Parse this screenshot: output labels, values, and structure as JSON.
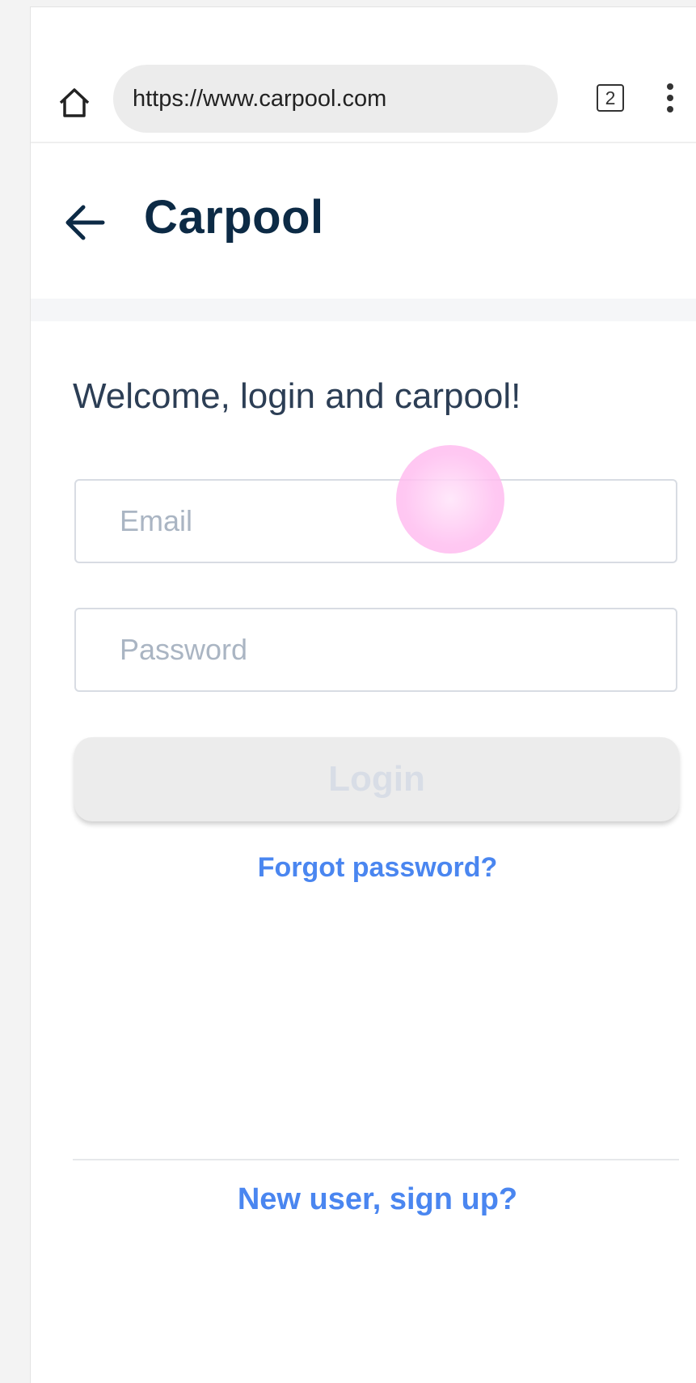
{
  "browser": {
    "url": "https://www.carpool.com",
    "tab_count": "2",
    "icons": [
      "home-icon",
      "tabs-icon",
      "more-vert-icon"
    ]
  },
  "app": {
    "title": "Carpool",
    "back_icon": "arrow-back-icon"
  },
  "login": {
    "welcome": "Welcome, login and carpool!",
    "email_placeholder": "Email",
    "email_value": "",
    "password_placeholder": "Password",
    "password_value": "",
    "login_label": "Login",
    "forgot_label": "Forgot password?",
    "signup_label": "New user, sign up?"
  },
  "colors": {
    "title": "#0c2a45",
    "link": "#4a86f0",
    "button_disabled_bg": "#ececec",
    "button_disabled_text": "#d8dde6",
    "touch_indicator": "#ffc4ef"
  }
}
